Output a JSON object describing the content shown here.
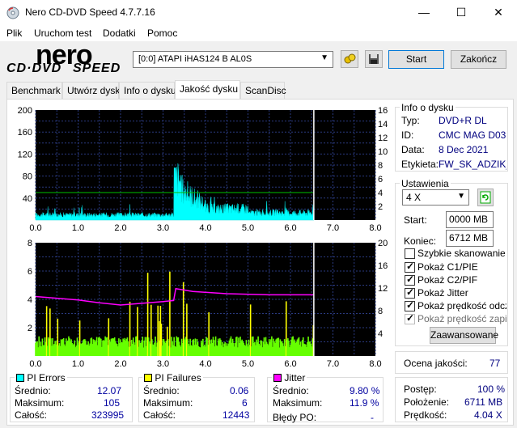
{
  "window": {
    "title": "Nero CD-DVD Speed 4.7.7.16",
    "min": "—",
    "max": "☐",
    "close": "✕"
  },
  "menu": [
    "Plik",
    "Uruchom test",
    "Dodatki",
    "Pomoc"
  ],
  "logo": {
    "nero": "nero",
    "cddvd": "CD·DVD",
    "speed": "SPEED"
  },
  "toolbar": {
    "drive": "[0:0]   ATAPI iHAS124   B AL0S",
    "start_label": "Start",
    "end_label": "Zakończ"
  },
  "tabs": [
    "Benchmark",
    "Utwórz dysk",
    "Info o dysku",
    "Jakość dysku",
    "ScanDisc"
  ],
  "active_tab": "Jakość dysku",
  "disc_info": {
    "title": "Info o dysku",
    "type_label": "Typ:",
    "type": "DVD+R DL",
    "id_label": "ID:",
    "id": "CMC MAG D03",
    "date_label": "Data:",
    "date": "8 Dec 2021",
    "label_label": "Etykieta:",
    "label": "FW_SK_ADZIK_"
  },
  "settings": {
    "title": "Ustawienia",
    "speed": "4 X",
    "start_label": "Start:",
    "start": "0000 MB",
    "end_label": "Koniec:",
    "end": "6712 MB",
    "quick_scan": "Szybkie skanowanie",
    "show_c1": "Pokaż C1/PIE",
    "show_c2": "Pokaż C2/PIF",
    "show_jitter": "Pokaż Jitter",
    "show_read": "Pokaż prędkość odczytu",
    "show_write": "Pokaż prędkość zapisu",
    "advanced": "Zaawansowane"
  },
  "quality": {
    "label": "Ocena jakości:",
    "value": "77"
  },
  "progress": {
    "progress_label": "Postęp:",
    "progress": "100 %",
    "position_label": "Położenie:",
    "position": "6711 MB",
    "speed_label": "Prędkość:",
    "speed": "4.04 X"
  },
  "pi_errors": {
    "title": "PI Errors",
    "color": "#00ffff",
    "avg_label": "Średnio:",
    "avg": "12.07",
    "max_label": "Maksimum:",
    "max": "105",
    "total_label": "Całość:",
    "total": "323995"
  },
  "pi_failures": {
    "title": "PI Failures",
    "color": "#ffff00",
    "avg_label": "Średnio:",
    "avg": "0.06",
    "max_label": "Maksimum:",
    "max": "6",
    "total_label": "Całość:",
    "total": "12443"
  },
  "jitter": {
    "title": "Jitter",
    "color": "#ff00ff",
    "avg_label": "Średnio:",
    "avg": "9.80 %",
    "max_label": "Maksimum:",
    "max": "11.9 %",
    "po_label": "Błędy PO:",
    "po": "-"
  },
  "chart_data": [
    {
      "type": "area",
      "name": "PI Errors",
      "xlim": [
        0,
        8
      ],
      "ylim": [
        0,
        200
      ],
      "y2lim": [
        0,
        16
      ],
      "x_ticks": [
        "0.0",
        "1.0",
        "2.0",
        "3.0",
        "4.0",
        "5.0",
        "6.0",
        "7.0",
        "8.0"
      ],
      "y_ticks": [
        "40",
        "80",
        "120",
        "160",
        "200"
      ],
      "y2_ticks": [
        "2",
        "4",
        "6",
        "8",
        "10",
        "12",
        "14",
        "16"
      ],
      "end_marker_x": 6.55,
      "pie_segments": [
        {
          "x0": 0.0,
          "x1": 3.25,
          "level": 10
        },
        {
          "x0": 3.25,
          "x1": 3.4,
          "level": 80
        },
        {
          "x0": 3.4,
          "x1": 4.0,
          "level": 35
        },
        {
          "x0": 4.0,
          "x1": 5.0,
          "level": 22
        },
        {
          "x0": 5.0,
          "x1": 6.55,
          "level": 14
        }
      ],
      "speed_line": [
        {
          "x": 0.0,
          "y": 4.0
        },
        {
          "x": 6.55,
          "y": 4.0
        }
      ]
    },
    {
      "type": "bar",
      "name": "PI Failures / Jitter",
      "xlim": [
        0,
        8
      ],
      "ylim": [
        0,
        8
      ],
      "y2lim": [
        0,
        20
      ],
      "x_ticks": [
        "0.0",
        "1.0",
        "2.0",
        "3.0",
        "4.0",
        "5.0",
        "6.0",
        "7.0",
        "8.0"
      ],
      "y_ticks": [
        "2",
        "4",
        "6",
        "8"
      ],
      "y2_ticks": [
        "4",
        "8",
        "12",
        "16",
        "20"
      ],
      "end_marker_x": 6.55,
      "jitter": [
        {
          "x": 0.0,
          "y": 10.5
        },
        {
          "x": 0.5,
          "y": 10.2
        },
        {
          "x": 1.0,
          "y": 9.9
        },
        {
          "x": 1.5,
          "y": 9.4
        },
        {
          "x": 2.0,
          "y": 9.0
        },
        {
          "x": 2.5,
          "y": 9.3
        },
        {
          "x": 3.0,
          "y": 9.6
        },
        {
          "x": 3.25,
          "y": 9.8
        },
        {
          "x": 3.3,
          "y": 11.9
        },
        {
          "x": 3.7,
          "y": 11.4
        },
        {
          "x": 4.5,
          "y": 11.0
        },
        {
          "x": 5.5,
          "y": 10.8
        },
        {
          "x": 6.55,
          "y": 10.8
        }
      ],
      "pif_base_level": 1
    }
  ]
}
